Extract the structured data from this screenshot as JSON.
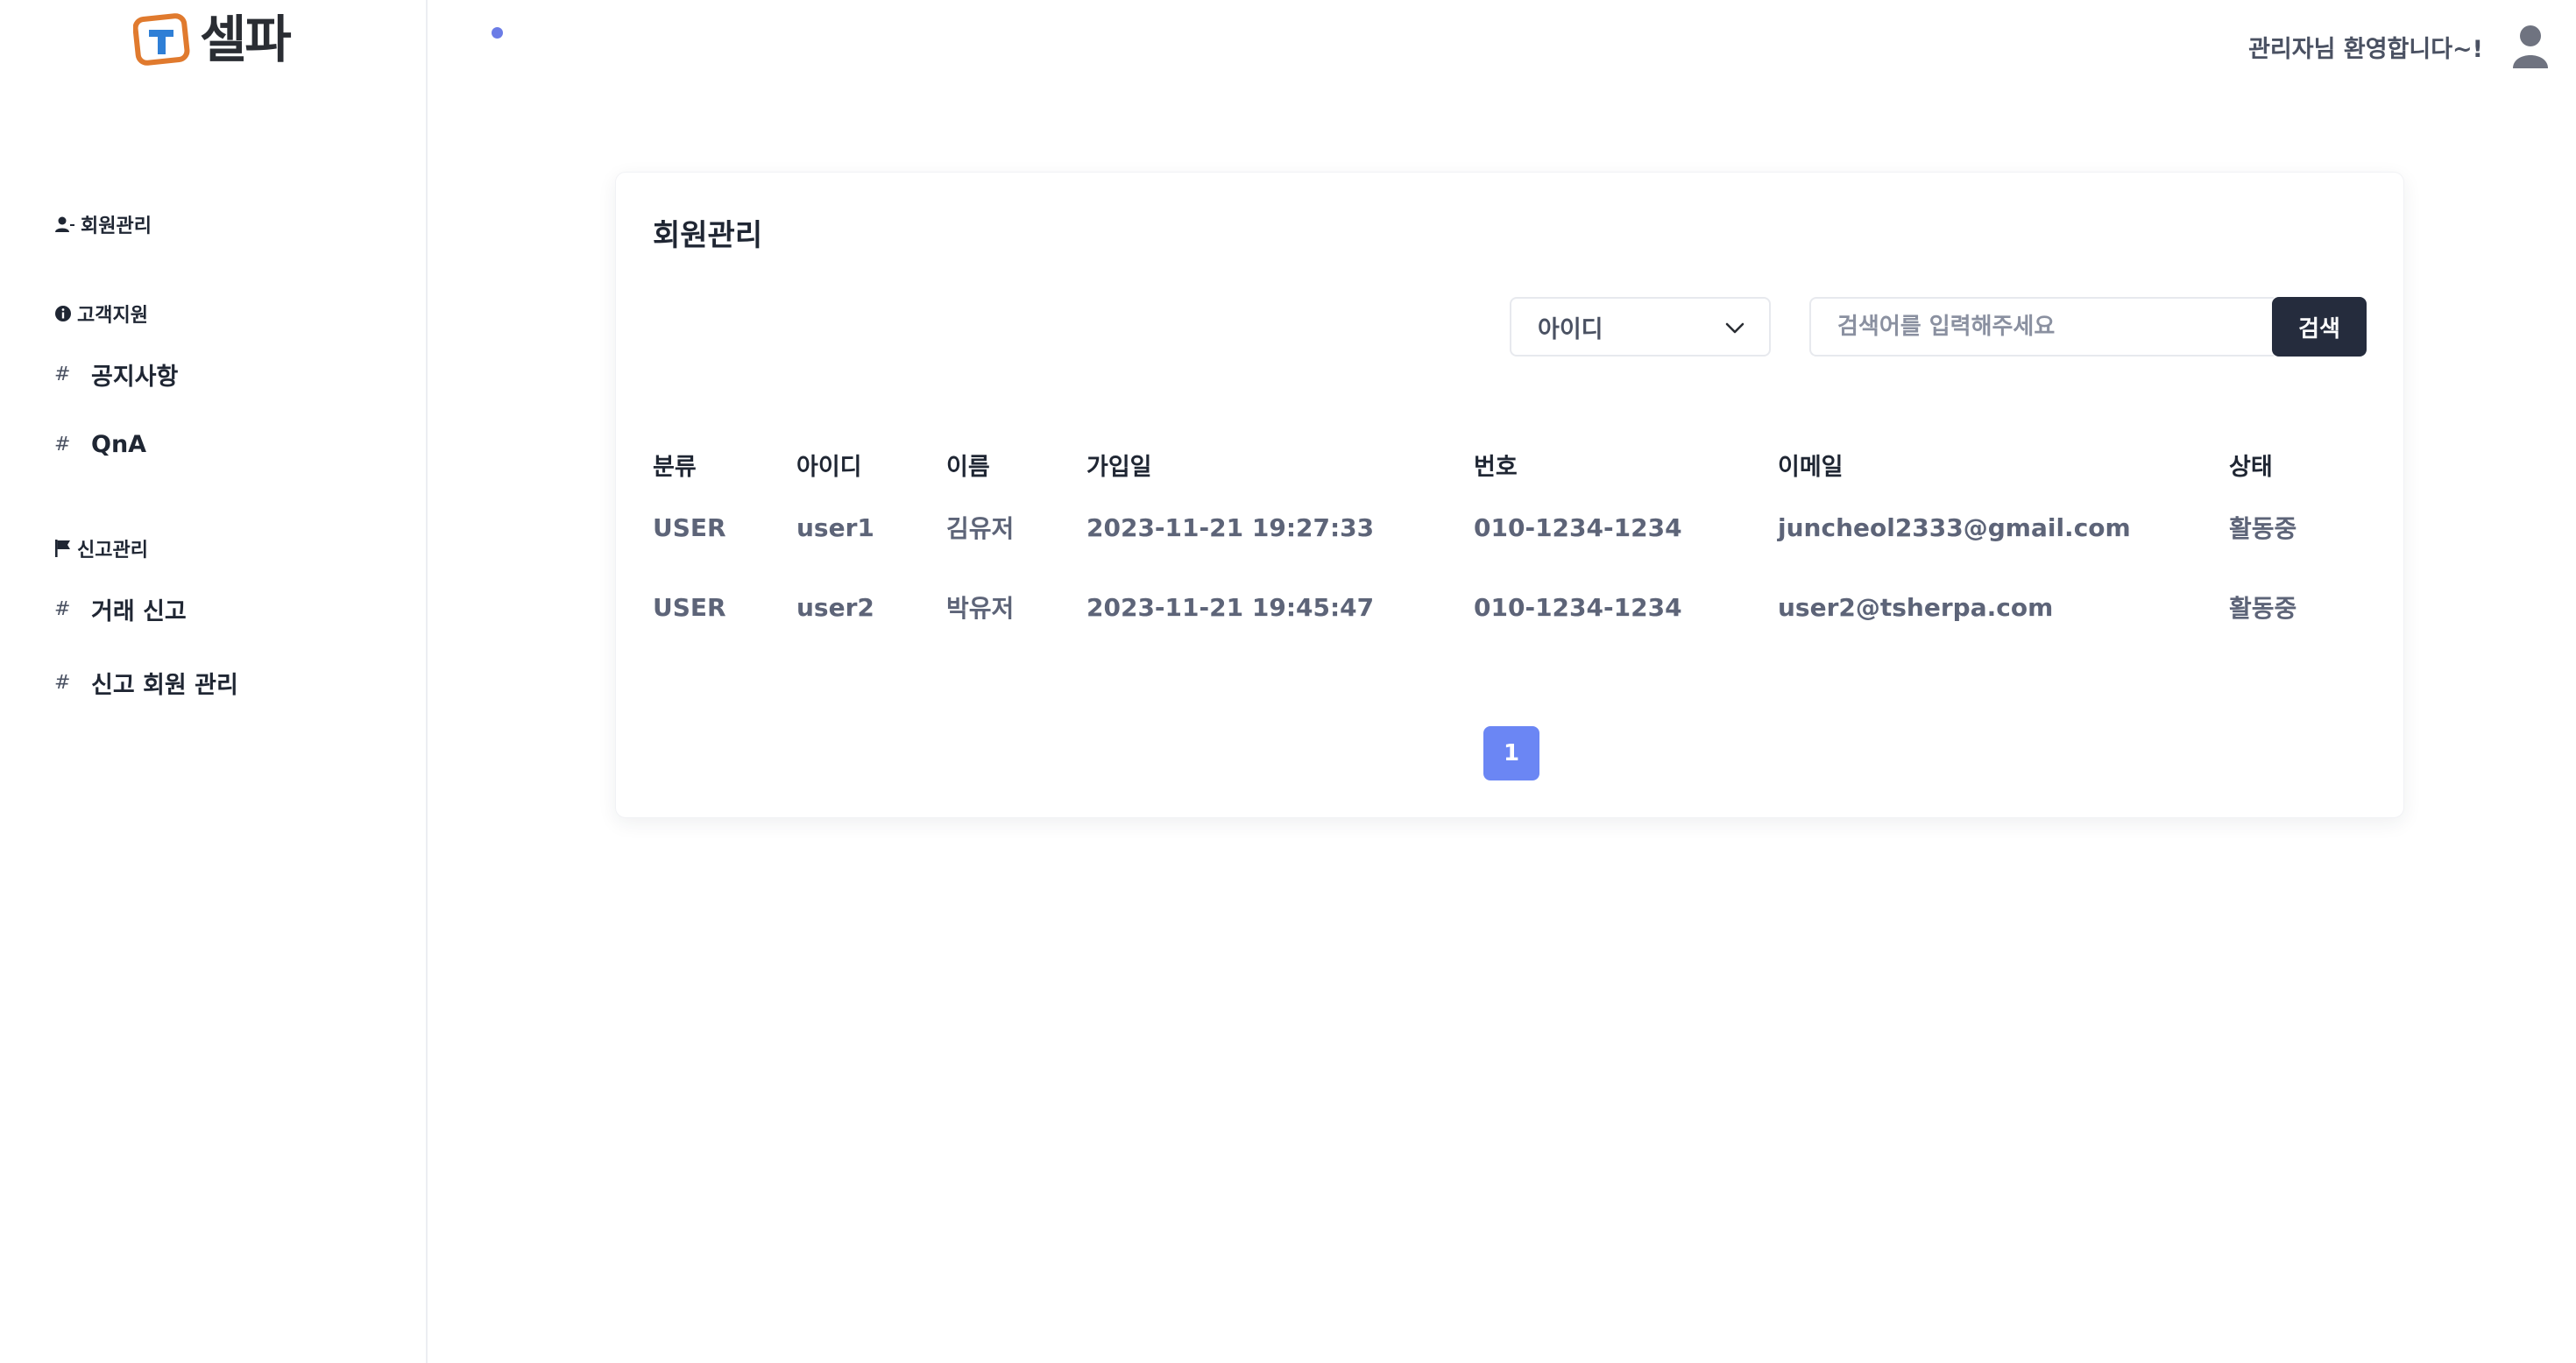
{
  "app": {
    "logo_text": "셀파",
    "welcome": "관리자님 환영합니다~!",
    "brand_color": "#e07a2e",
    "accent": "#6b86f4"
  },
  "sidebar": {
    "members_section": "회원관리",
    "support_section": "고객지원",
    "support_items": [
      {
        "label": "공지사항"
      },
      {
        "label": "QnA"
      }
    ],
    "report_section": "신고관리",
    "report_items": [
      {
        "label": "거래 신고"
      },
      {
        "label": "신고 회원 관리"
      }
    ],
    "hash": "#"
  },
  "main": {
    "title": "회원관리",
    "filter_selected": "아이디",
    "search_placeholder": "검색어를 입력해주세요",
    "search_button": "검색",
    "columns": [
      "분류",
      "아이디",
      "이름",
      "가입일",
      "번호",
      "이메일",
      "상태"
    ],
    "rows": [
      [
        "USER",
        "user1",
        "김유저",
        "2023-11-21 19:27:33",
        "010-1234-1234",
        "juncheol2333@gmail.com",
        "활동중"
      ],
      [
        "USER",
        "user2",
        "박유저",
        "2023-11-21 19:45:47",
        "010-1234-1234",
        "user2@tsherpa.com",
        "활동중"
      ]
    ],
    "current_page": "1"
  }
}
